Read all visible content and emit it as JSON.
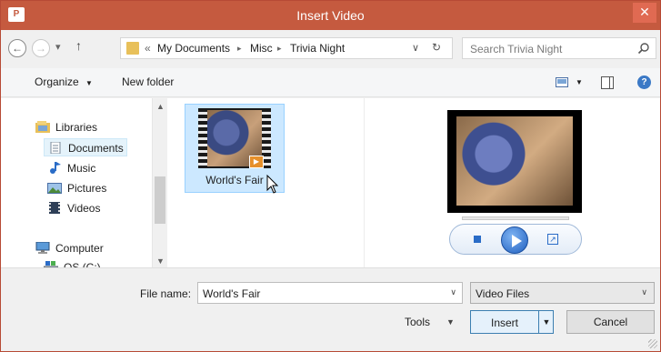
{
  "window": {
    "title": "Insert Video",
    "app_icon_text": "P",
    "close_glyph": "✕"
  },
  "nav": {
    "back_glyph": "←",
    "forward_glyph": "→",
    "recent_glyph": "▾",
    "up_glyph": "↑",
    "overflow_glyph": "«",
    "breadcrumbs": [
      "My Documents",
      "Misc",
      "Trivia Night"
    ],
    "separator_glyph": "▸",
    "dropdown_glyph": "∨",
    "refresh_glyph": "↻",
    "search_placeholder": "Search Trivia Night"
  },
  "toolbar": {
    "organize_label": "Organize",
    "organize_arrow": "▼",
    "new_folder_label": "New folder",
    "view_arrow": "▼",
    "help_glyph": "?"
  },
  "tree": {
    "items": [
      {
        "label": "Libraries",
        "icon": "libraries-icon"
      },
      {
        "label": "Documents",
        "icon": "documents-icon",
        "selected": true
      },
      {
        "label": "Music",
        "icon": "music-icon"
      },
      {
        "label": "Pictures",
        "icon": "pictures-icon"
      },
      {
        "label": "Videos",
        "icon": "videos-icon"
      },
      {
        "label": "Computer",
        "icon": "computer-icon"
      },
      {
        "label": "OS (C:)",
        "icon": "drive-icon"
      }
    ],
    "scroll_up": "▲",
    "scroll_down": "▼"
  },
  "files": [
    {
      "name": "World's Fair",
      "type": "video",
      "selected": true
    }
  ],
  "preview": {
    "stop_glyph": "",
    "expand_glyph": "↗"
  },
  "bottom": {
    "file_name_label": "File name:",
    "file_name_value": "World's Fair",
    "file_name_arrow": "∨",
    "file_type_value": "Video Files",
    "file_type_arrow": "∨",
    "tools_label": "Tools",
    "tools_arrow": "▼",
    "insert_label": "Insert",
    "insert_arrow": "▼",
    "cancel_label": "Cancel"
  },
  "colors": {
    "titlebar": "#c55a3f",
    "selection": "#cce8ff",
    "accent": "#2a6cc7"
  }
}
